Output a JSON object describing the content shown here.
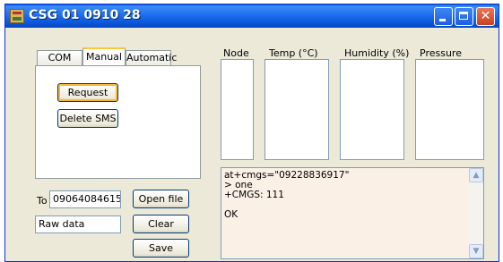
{
  "window": {
    "title": "CSG 01 0910 28",
    "icons": {
      "app": "app-icon",
      "minimize": "minimize-icon",
      "maximize": "maximize-icon",
      "close": "close-icon"
    }
  },
  "tabs": [
    {
      "label": "COM Port"
    },
    {
      "label": "Manual",
      "active": true
    },
    {
      "label": "Automatic"
    }
  ],
  "manual": {
    "request_label": "Request",
    "delete_sms_label": "Delete SMS"
  },
  "sensors": {
    "node_label": "Node",
    "temp_label": "Temp (°C)",
    "humidity_label": "Humidity (%)",
    "pressure_label": "Pressure"
  },
  "phone": {
    "to_label": "To",
    "to_value": "09064084615",
    "raw_value": "Raw data"
  },
  "actions": {
    "open_file_label": "Open file",
    "clear_label": "Clear",
    "save_label": "Save"
  },
  "log": {
    "lines": [
      "at+cmgs=\"09228836917\"",
      "> one",
      "+CMGS: 111",
      "",
      "OK"
    ]
  },
  "colors": {
    "titlebar": "#0a55d8",
    "window_bg": "#ece9d8",
    "log_bg": "#faf0e6",
    "focus_accent": "#f8b636"
  }
}
